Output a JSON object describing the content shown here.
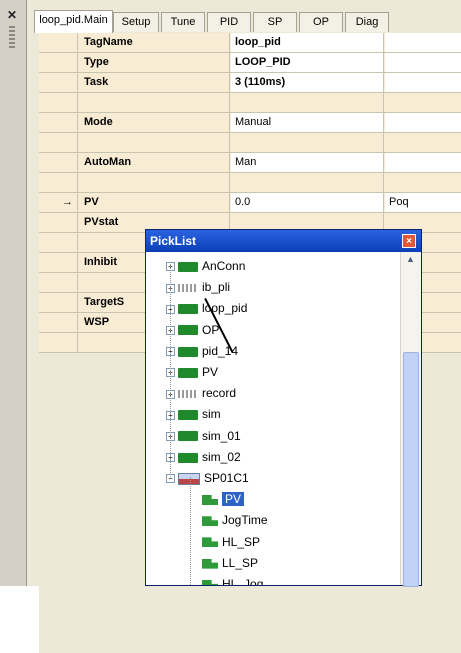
{
  "tabs": [
    "loop_pid.Main",
    "Setup",
    "Tune",
    "PID",
    "SP",
    "OP",
    "Diag"
  ],
  "rows": [
    {
      "label": "TagName",
      "value": "loop_pid",
      "extra": "",
      "vbold": true,
      "white": true
    },
    {
      "label": "Type",
      "value": "LOOP_PID",
      "extra": "",
      "vbold": true,
      "white": false
    },
    {
      "label": "Task",
      "value": "3 (110ms)",
      "extra": "",
      "vbold": true,
      "white": true
    },
    {
      "label": "",
      "value": "",
      "extra": "",
      "vbold": false,
      "white": false
    },
    {
      "label": "Mode",
      "value": "Manual",
      "extra": "",
      "vbold": false,
      "white": false
    },
    {
      "label": "",
      "value": "",
      "extra": "",
      "vbold": false,
      "white": false
    },
    {
      "label": "AutoMan",
      "value": "Man",
      "extra": "",
      "vbold": false,
      "white": false
    },
    {
      "label": "",
      "value": "",
      "extra": "",
      "vbold": false,
      "white": false
    },
    {
      "label": "PV",
      "value": "0.0",
      "extra": "Poq",
      "vbold": false,
      "white": false,
      "arrow": "→"
    },
    {
      "label": "PVstat",
      "value": "",
      "extra": "",
      "vbold": false,
      "white": false
    },
    {
      "label": "",
      "value": "",
      "extra": "",
      "vbold": false,
      "white": false
    },
    {
      "label": "Inhibit",
      "value": "",
      "extra": "",
      "vbold": false,
      "white": false
    },
    {
      "label": "",
      "value": "",
      "extra": "",
      "vbold": false,
      "white": false
    },
    {
      "label": "TargetS",
      "value": "",
      "extra": "",
      "vbold": false,
      "white": false
    },
    {
      "label": "WSP",
      "value": "",
      "extra": "",
      "vbold": false,
      "white": false
    },
    {
      "label": "",
      "value": "",
      "extra": "",
      "vbold": false,
      "white": false
    }
  ],
  "picklist": {
    "title": "PickList",
    "close": "×",
    "items": [
      {
        "label": "AnConn",
        "icon": "green-block-icon",
        "level": 0,
        "exp": "+"
      },
      {
        "label": "ib_pli",
        "icon": "dashed-block-icon",
        "level": 0,
        "exp": "+"
      },
      {
        "label": "loop_pid",
        "icon": "green-block-icon",
        "level": 0,
        "exp": "+"
      },
      {
        "label": "OP",
        "icon": "green-block-icon",
        "level": 0,
        "exp": "+"
      },
      {
        "label": "pid_14",
        "icon": "green-block-icon",
        "level": 0,
        "exp": "+"
      },
      {
        "label": "PV",
        "icon": "green-block-icon",
        "level": 0,
        "exp": "+"
      },
      {
        "label": "record",
        "icon": "dashed-block-icon",
        "level": 0,
        "exp": "+"
      },
      {
        "label": "sim",
        "icon": "green-block-icon",
        "level": 0,
        "exp": "+"
      },
      {
        "label": "sim_01",
        "icon": "green-block-icon",
        "level": 0,
        "exp": "+"
      },
      {
        "label": "sim_02",
        "icon": "green-block-icon",
        "level": 0,
        "exp": "+"
      },
      {
        "label": "SP01C1",
        "icon": "sp-block-icon",
        "level": 0,
        "exp": "−"
      },
      {
        "label": "PV",
        "icon": "tag-leaf-icon",
        "level": 1,
        "exp": "",
        "selected": true
      },
      {
        "label": "JogTime",
        "icon": "tag-leaf-icon",
        "level": 1,
        "exp": ""
      },
      {
        "label": "HL_SP",
        "icon": "tag-leaf-icon",
        "level": 1,
        "exp": ""
      },
      {
        "label": "LL_SP",
        "icon": "tag-leaf-icon",
        "level": 1,
        "exp": ""
      },
      {
        "label": "HL_Jog",
        "icon": "tag-leaf-icon",
        "level": 1,
        "exp": ""
      }
    ]
  }
}
